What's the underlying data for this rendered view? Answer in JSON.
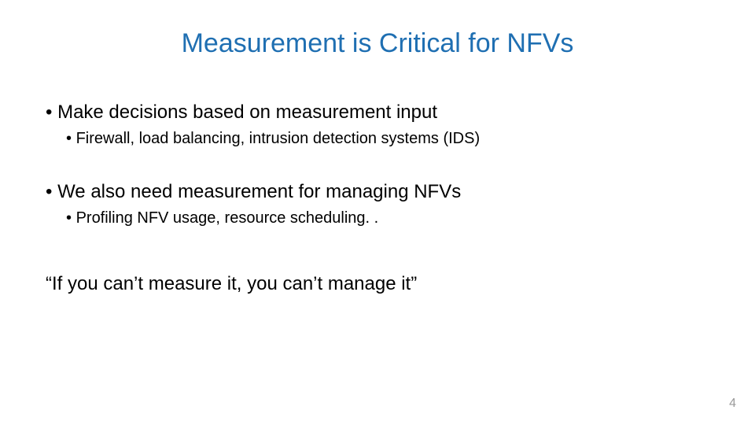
{
  "title": "Measurement is Critical for NFVs",
  "bullets": [
    {
      "text": "Make decisions based on measurement input",
      "sub": [
        {
          "text": "Firewall, load balancing, intrusion detection systems (IDS)"
        }
      ]
    },
    {
      "text": "We also need measurement for managing NFVs",
      "sub": [
        {
          "text": "Profiling NFV usage, resource scheduling. ."
        }
      ]
    }
  ],
  "quote": "“If you can’t measure it, you can’t manage it”",
  "page_number": "4"
}
